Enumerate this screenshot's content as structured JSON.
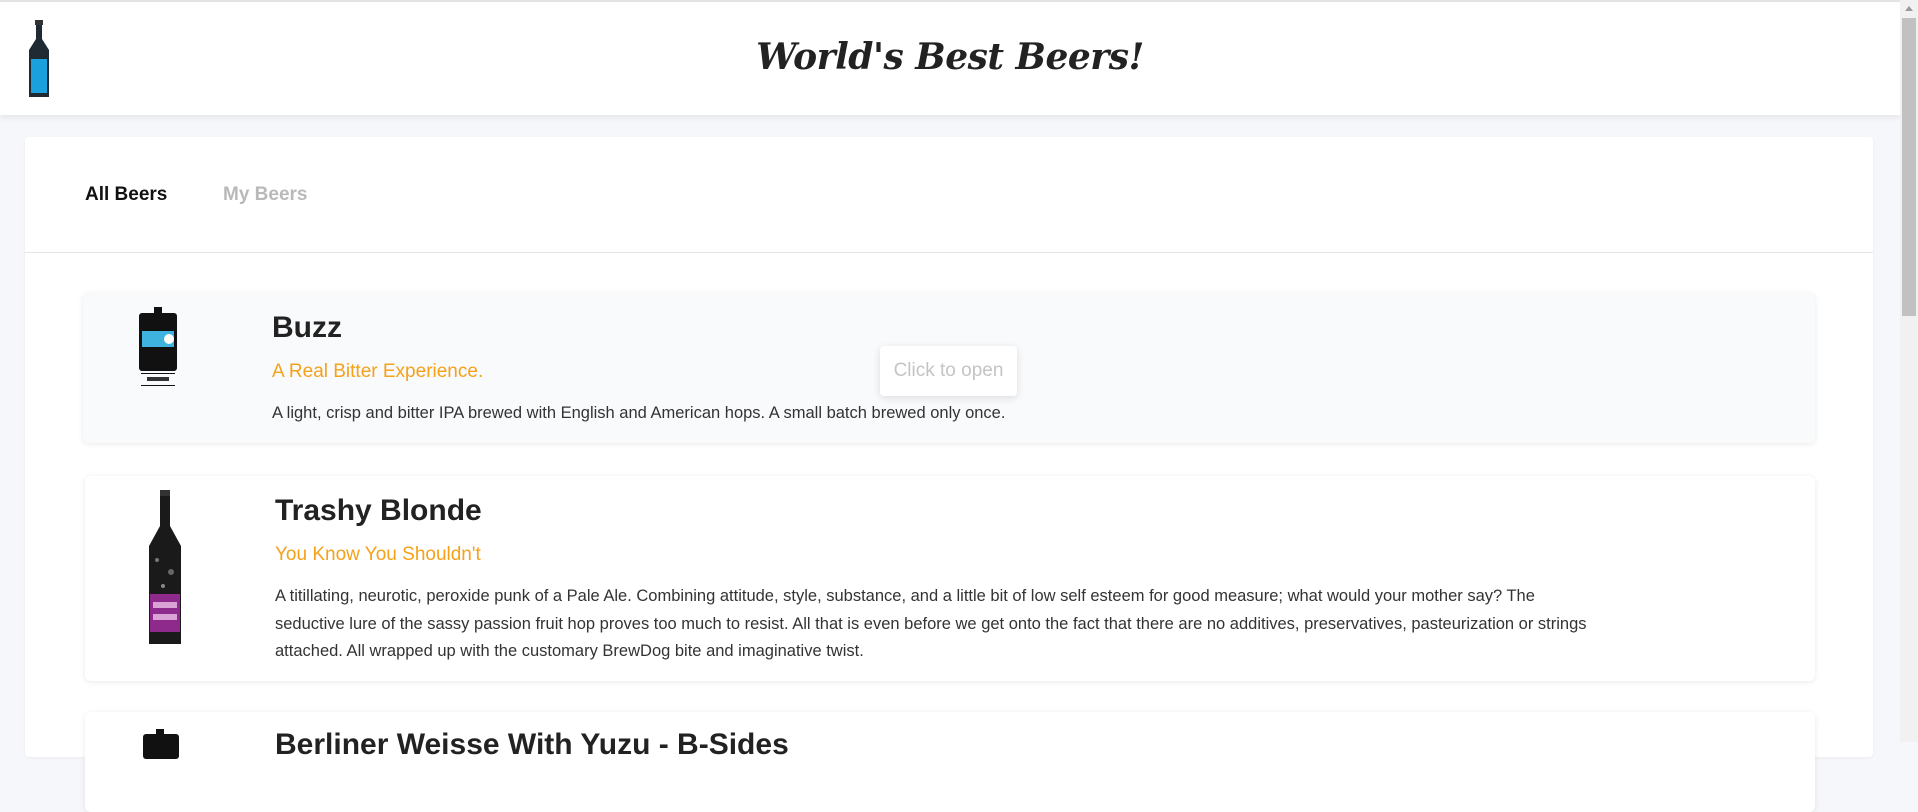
{
  "header": {
    "title": "World's Best Beers!",
    "logo_icon": "beer-bottle-icon"
  },
  "tabs": [
    {
      "label": "All Beers",
      "active": true
    },
    {
      "label": "My Beers",
      "active": false
    }
  ],
  "beers": [
    {
      "name": "Buzz",
      "tagline": "A Real Bitter Experience.",
      "description": "A light, crisp and bitter IPA brewed with English and American hops. A small batch brewed only once.",
      "image_icon": "beer-keg-icon"
    },
    {
      "name": "Trashy Blonde",
      "tagline": "You Know You Shouldn't",
      "description": "A titillating, neurotic, peroxide punk of a Pale Ale. Combining attitude, style, substance, and a little bit of low self esteem for good measure; what would your mother say? The seductive lure of the sassy passion fruit hop proves too much to resist. All that is even before we get onto the fact that there are no additives, preservatives, pasteurization or strings attached. All wrapped up with the customary BrewDog bite and imaginative twist.",
      "image_icon": "beer-bottle-icon"
    },
    {
      "name": "Berliner Weisse With Yuzu - B-Sides",
      "image_icon": "beer-keg-icon"
    }
  ],
  "hover_hint": "Click to open",
  "colors": {
    "accent": "#f5a11a",
    "background": "#f6f7fb",
    "logo_bottle": "#1aa0dc"
  }
}
